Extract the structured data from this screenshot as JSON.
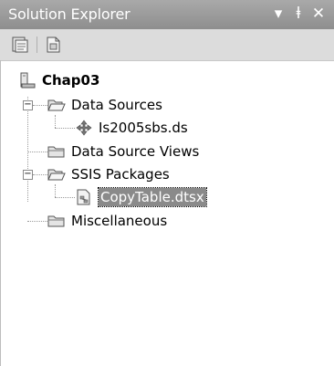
{
  "window": {
    "title": "Solution Explorer",
    "dropdown_icon": "dropdown-arrow-icon",
    "pin_icon": "pin-icon",
    "close_icon": "close-icon",
    "title_colors": {
      "bar": "#999999",
      "text": "#ffffff"
    }
  },
  "toolbar": {
    "buttons": [
      {
        "icon": "properties-icon"
      },
      {
        "icon": "show-all-files-icon"
      }
    ]
  },
  "tree": {
    "root": {
      "label": "Chap03",
      "icon": "project-icon"
    },
    "nodes": [
      {
        "label": "Data Sources",
        "icon": "folder-open-icon",
        "expander": "−"
      },
      {
        "label": "Is2005sbs.ds",
        "icon": "data-source-icon"
      },
      {
        "label": "Data Source Views",
        "icon": "folder-icon"
      },
      {
        "label": "SSIS Packages",
        "icon": "folder-open-icon",
        "expander": "−"
      },
      {
        "label": "CopyTable.dtsx",
        "icon": "package-icon",
        "selected": true
      },
      {
        "label": "Miscellaneous",
        "icon": "folder-icon"
      }
    ]
  }
}
